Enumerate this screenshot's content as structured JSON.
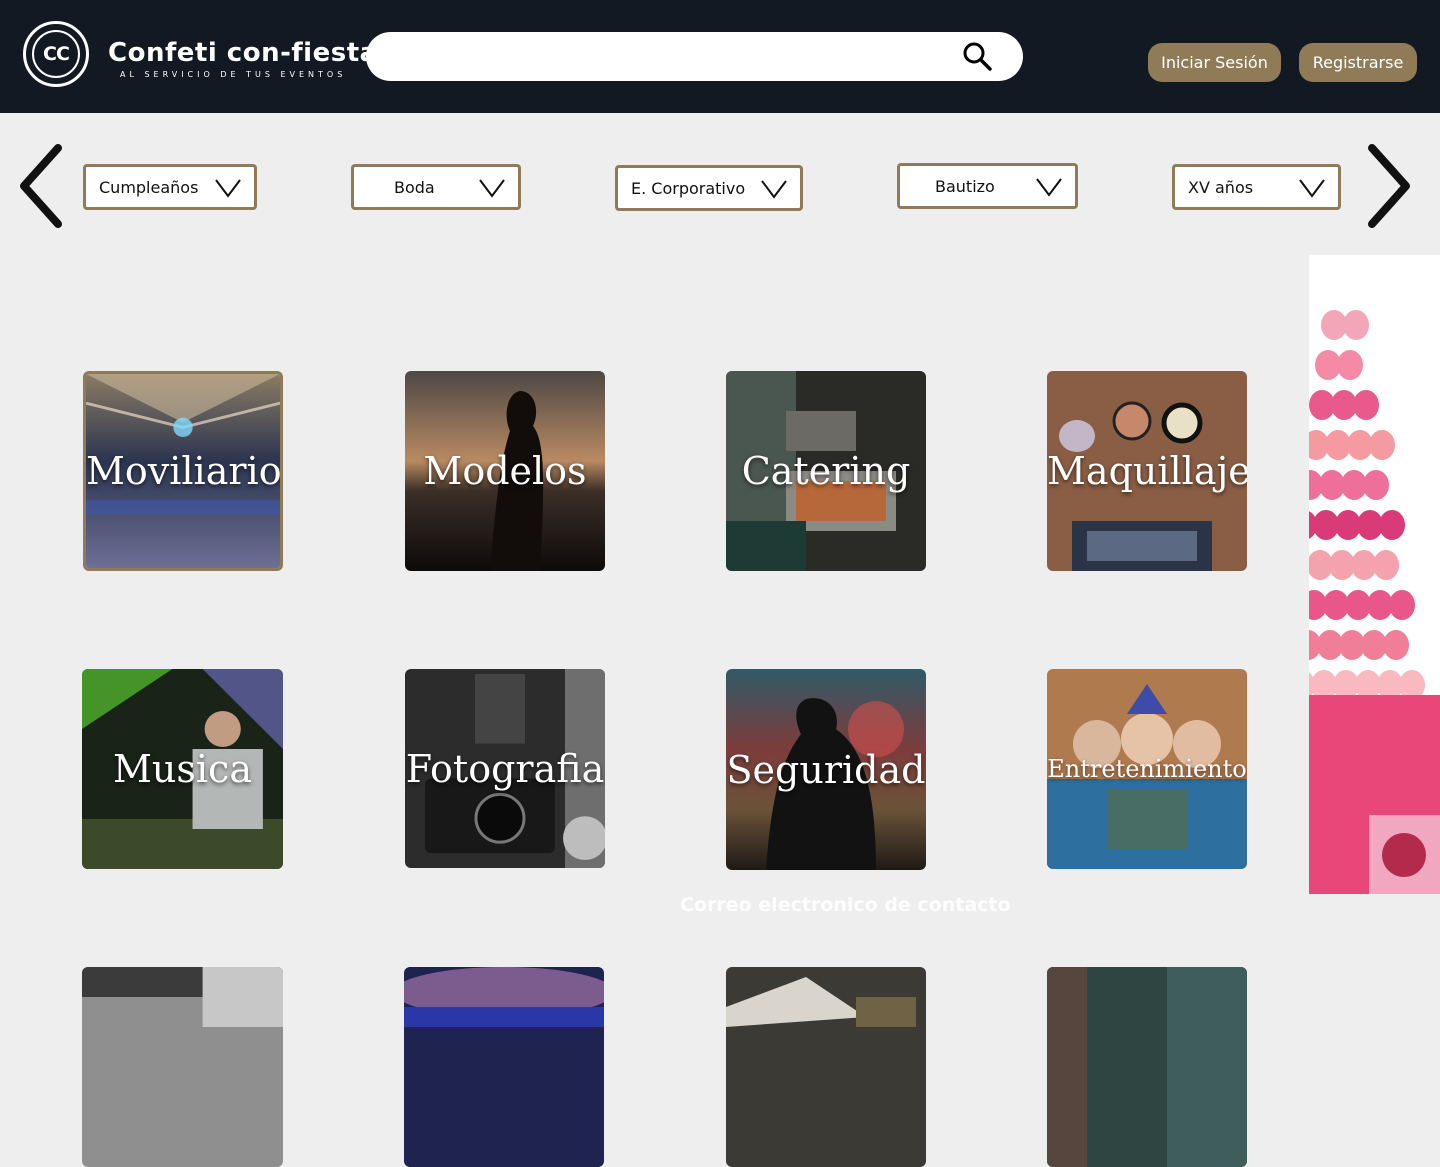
{
  "header": {
    "logo_text": "CC",
    "brand_name": "Confeti con-fiesta",
    "brand_tagline": "AL SERVICIO DE TUS EVENTOS",
    "search_placeholder": "",
    "login_label": "Iniciar Sesión",
    "register_label": "Registrarse"
  },
  "categories": [
    {
      "label": "Cumpleaños"
    },
    {
      "label": "Boda"
    },
    {
      "label": "E. Corporativo"
    },
    {
      "label": "Bautizo"
    },
    {
      "label": "XV años"
    }
  ],
  "services": [
    {
      "label": "Moviliario"
    },
    {
      "label": "Modelos"
    },
    {
      "label": "Catering"
    },
    {
      "label": "Maquillaje"
    },
    {
      "label": "Musica"
    },
    {
      "label": "Fotografia"
    },
    {
      "label": "Seguridad"
    },
    {
      "label": "Entretenimiento"
    }
  ],
  "footer": {
    "contact_label": "Correo electronico de contacto"
  },
  "colors": {
    "header_bg": "#121923",
    "accent": "#8f7b57",
    "page_bg": "#eeeeee"
  },
  "icons": [
    "search-icon",
    "chevron-left-icon",
    "chevron-right-icon",
    "chevron-down-icon"
  ]
}
